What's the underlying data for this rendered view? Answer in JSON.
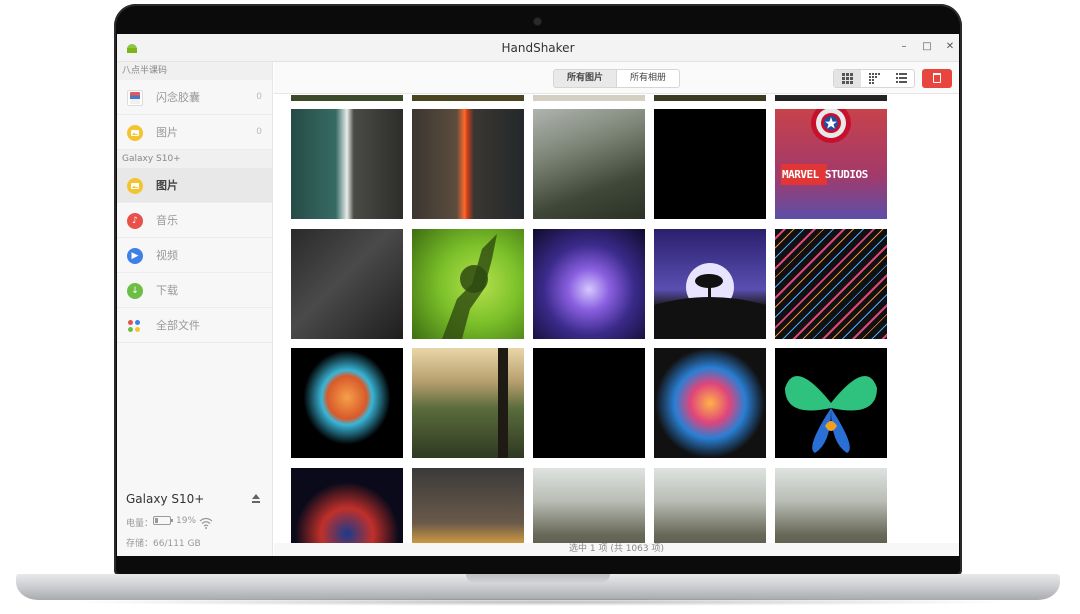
{
  "window": {
    "title": "HandShaker",
    "minimize_glyph": "–",
    "maximize_glyph": "□",
    "close_glyph": "✕",
    "app_icon": "android-icon"
  },
  "sidebar": {
    "top_section_label": "八点半课码",
    "top_items": [
      {
        "label": "闪念胶囊",
        "count": "0",
        "icon": "flash-capsule-icon"
      },
      {
        "label": "图片",
        "count": "0",
        "icon": "photo-icon"
      }
    ],
    "device_section_label": "Galaxy S10+",
    "device_items": [
      {
        "label": "图片",
        "icon": "photo-icon",
        "active": true
      },
      {
        "label": "音乐",
        "icon": "music-icon"
      },
      {
        "label": "视频",
        "icon": "video-icon"
      },
      {
        "label": "下载",
        "icon": "download-icon"
      },
      {
        "label": "全部文件",
        "icon": "all-files-icon"
      }
    ]
  },
  "device": {
    "name": "Galaxy S10+",
    "battery_label": "电量：",
    "battery_percent": "19%",
    "battery_level": 0.19,
    "storage_text": "存储：66/111 GB"
  },
  "toolbar": {
    "tab_all_photos": "所有图片",
    "tab_all_albums": "所有相册",
    "view_modes": [
      "large-grid-icon",
      "small-grid-icon",
      "list-grid-icon"
    ],
    "active_view": "large-grid-icon",
    "delete_icon": "trash-icon"
  },
  "grid": {
    "rows": [
      [
        "coastline-aerial",
        "firefall-cliff",
        "misty-mountains",
        "black",
        "marvel-studios"
      ],
      [
        "dark-leaf",
        "frog-shadow-leaf",
        "purple-nebula",
        "moon-tree",
        "neon-streaks"
      ],
      [
        "fire-island-splash",
        "forest-valley",
        "black",
        "colorful-smoke",
        "galaxy-fold-butterfly"
      ],
      [
        "blue-red-nebula",
        "avengers-poster",
        "tree-lined-road-1",
        "tree-lined-road-2",
        "tree-lined-road-3"
      ]
    ],
    "marvel_text": "MARVEL STUDIOS"
  },
  "status": {
    "text": "选中 1 项 (共 1063 项)"
  },
  "colors": {
    "accent_delete": "#e9453f",
    "photo_icon": "#f4c430",
    "music_icon": "#e8504a",
    "video_icon": "#3f7fe8",
    "download_icon": "#6dbe45"
  }
}
